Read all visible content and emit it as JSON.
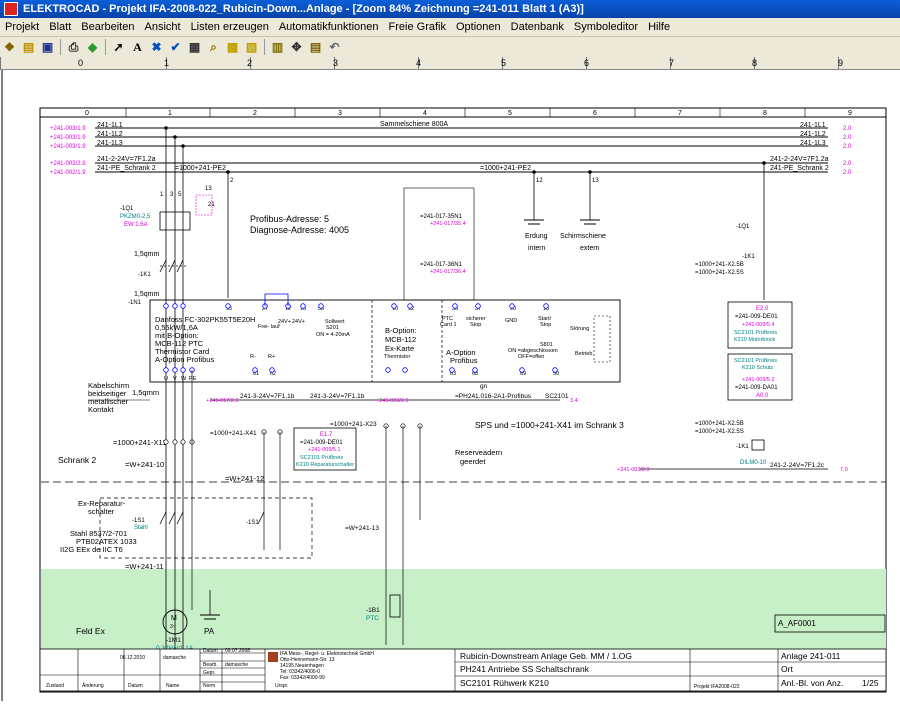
{
  "window": {
    "title": "ELEKTROCAD - Projekt IFA-2008-022_Rubicin-Down...Anlage - [Zoom 84% Zeichnung =241-011 Blatt 1 (A3)]"
  },
  "menu": [
    "Projekt",
    "Blatt",
    "Bearbeiten",
    "Ansicht",
    "Listen erzeugen",
    "Automatikfunktionen",
    "Freie Grafik",
    "Optionen",
    "Datenbank",
    "Symboleditor",
    "Hilfe"
  ],
  "ruler": [
    "0",
    "1",
    "2",
    "3",
    "4",
    "5",
    "6",
    "7",
    "8",
    "9"
  ],
  "colors": {
    "pink": "#e000e0",
    "teal": "#008080",
    "greenzone": "#c8f0c8",
    "blue": "#0000c0"
  },
  "drawing": {
    "grid_numbers": [
      "0",
      "1",
      "2",
      "3",
      "4",
      "5",
      "6",
      "7",
      "8",
      "9"
    ],
    "busbar_title": "Sammelschiene 800A",
    "bus": {
      "l1": "241-1L1",
      "l2": "241-1L2",
      "l3": "241-1L3",
      "l1_ref_left": "+241-003/1.9",
      "l2_ref_left": "+241-003/1.9",
      "l3_ref_left": "+241-003/1.9",
      "l1_r": "241-1L1",
      "l2_r": "241-1L2",
      "l3_r": "241-1L3",
      "ref_right1": "2.0",
      "ref_right2": "2.0",
      "ref_right3": "2.0",
      "v24": "241-2-24V=7F1.2a",
      "pe": "241-PE_Schrank 2",
      "v24_ref": "+241-003/2.9",
      "pe_ref": "+241-002/1.9",
      "v24_r": "241-2-24V=7F1.2a",
      "pe_r": "241-PE_Schrank 2",
      "pe2": "=1000+241-PE2",
      "pe2_mid": "=1000+241-PE2",
      "num2": "2",
      "num12": "12",
      "num13": "13"
    },
    "q1": {
      "label": "-1Q1",
      "type": "PKZM0-2,5",
      "ew": "EW:1,6A",
      "c1": "1,5qmm",
      "c2": "1,5qmm",
      "k1": "-1K1",
      "n1": "-1N1",
      "p1": "1",
      "p3": "3",
      "p5": "5",
      "p2": "2",
      "p4": "4",
      "p6": "6",
      "p13": "13",
      "p14": "14",
      "p21": "21",
      "p22": "22"
    },
    "profibus": {
      "adr": "Profibus-Adresse: 5",
      "diag": "Diagnose-Adresse: 4005"
    },
    "fu": {
      "line1": "Danfoss FC-302PK55T5E20H",
      "line2": "0,55kW/1,6A",
      "line3": "mit B-Option:",
      "line4": "MCB-112 PTC",
      "line5": "Thermistor Card",
      "line6": "A-Option Profibus",
      "t95": "95",
      "t27": "27",
      "t12": "12",
      "t13": "13",
      "t53": "53",
      "t10": "10",
      "t12b": "12",
      "t33": "33",
      "t37": "37",
      "t20": "20",
      "t18": "18",
      "t55": "55",
      "frei": "Frei-\nlauf",
      "v24a": "24V+",
      "v24b": "24V+",
      "soll": "Sollwert",
      "s201": "S201",
      "on": "ON = 4-20mA",
      "bopt": "B-Option:",
      "mcb": "MCB-112",
      "ex": "Ex-Karte",
      "ptc": "PTC",
      "card": "Card 1",
      "sich": "sicherer",
      "stop": "Stop",
      "gnd": "GND",
      "start": "Start/",
      "stop2": "Stop",
      "stoer": "Störung",
      "betr": "Betrieb",
      "aopt": "A-Option",
      "pb": "Profibus",
      "s801": "S801",
      "s801b": "ON =abgeschlossen",
      "s801c": "OFF=offen",
      "rm": "R-",
      "rp": "R+",
      "therm": "Thermistor",
      "b61": "61",
      "b62": "62",
      "b63": "63",
      "b68": "68",
      "b69": "69",
      "b50": "50",
      "u": "U",
      "v": "V",
      "w": "W",
      "pe": "PE"
    },
    "right_parts": {
      "q1": "-1Q1",
      "k1": "-1K1",
      "x5b": "=1000+241-X2.5B",
      "x5s": "=1000+241-X2.5S",
      "e20": "E2.0",
      "d01": "=241-009-DE01",
      "d01ref": "+241-009/5.4",
      "pr1": "SC2101 Prüfkreis",
      "pr1b": "K210 Motorblock",
      "pr2": "SC2101 Prüfkreis",
      "pr2b": "K210 Schütz",
      "a00": "A0.0",
      "da01": "=241-009-DA01",
      "da01ref": "+241-009/5.2",
      "x5b2": "=1000+241-X2.5B",
      "x5s2": "=1000+241-X2.5S",
      "k1b": "-1K1",
      "dilm": "DILM0-10",
      "ref7": "7.0",
      "refa": "+241-003/2.9",
      "v24c": "241-2-24V=7F1.2c"
    },
    "mid": {
      "n1a": "=241-017-35N1",
      "n1aref": "+241-017/35.4",
      "n1b": "=241-017-36N1",
      "n1bref": "+241-017/36.4",
      "erd1": "Erdung",
      "erd2": "Schirmschiene",
      "erd3": "intern",
      "erd4": "extern",
      "v24f": "241-3-24V=7F1.1b",
      "v24f2": "241-3-24V=7F1.1b",
      "pb1": "=PH241.016-2A1-Profibus",
      "sc": "SC2101",
      "ref34": "3.4",
      "ref20": "+241-017/2.9",
      "ref21": "+241-003/2.9",
      "ref22": "+241-005/2.9",
      "sps": "SPS und =1000+241-X41 im Schrank 3",
      "x23": "=1000+241-X23",
      "x41": "=1000+241-X41",
      "de01": "=241-009-DE01",
      "de01ref": "+241-009/5.1",
      "e17": "E1.7",
      "pk1": "SC2101 Prüfkreis",
      "pk2": "K210 Reparaturschalter",
      "reserve": "Reserveadern",
      "geerdet": "geerdet",
      "w241": "=W+241-13",
      "gn": "gn"
    },
    "left": {
      "kabel1": "Kabelschirm",
      "kabel2": "beidseitiger",
      "kabel3": "metallischer",
      "kabel4": "Kontakt",
      "c15": "1,5qmm",
      "x11": "=1000+241-X11",
      "schrank2": "Schrank 2",
      "w10": "=W+241-10",
      "w12": "=W+241-12",
      "w11": "=W+241-11",
      "rep1": "Ex-Reparatur-",
      "rep2": "schalter",
      "s1": "-1S1",
      "stahl": "Stahl",
      "st1": "Stahl 8537/2-701",
      "st2": "PTB02ATEX 1033",
      "st3": "II2G EEx de IIC T6",
      "m1": "-1M1",
      "mtype": "0,37kW/1,1A",
      "pa": "PA",
      "feld": "Feld Ex",
      "b1s1": "-1B1",
      "ptc": "PTC"
    },
    "titleblock": {
      "afcode": "A_AF0001",
      "anlage": "Anlage  241-011",
      "ort": "Ort",
      "anl": "Anl.-Bl. von Anz.",
      "page": "1/25",
      "t1": "Rubicin-Downstream Anlage Geb. MM / 1.OG",
      "t2": "PH241 Antriebe SS Schaltschrank",
      "t3": "SC2101 Rühwerk K210",
      "proj": "Projekt  IFA2008-022",
      "date1": "06.12.2010",
      "name1": "damasche",
      "datum": "Datum",
      "d2": "09.07.2008",
      "bearb": "Bearb.",
      "bname": "damasche",
      "gepr": "Gepr.",
      "norm": "Norm",
      "company": "IFA Mess-, Regel- u. Elektrotechnik GmbH",
      "c2": "Otto-Hennemann-Str. 13",
      "c3": "14195 Neuenhagen",
      "c4": "Tel: 03342/4000-0",
      "c5": "Fax: 03342/4000-99",
      "zust": "Zustand",
      "aend": "Änderung",
      "dat": "Datum",
      "name": "Name",
      "urspr": "Urspr."
    }
  }
}
